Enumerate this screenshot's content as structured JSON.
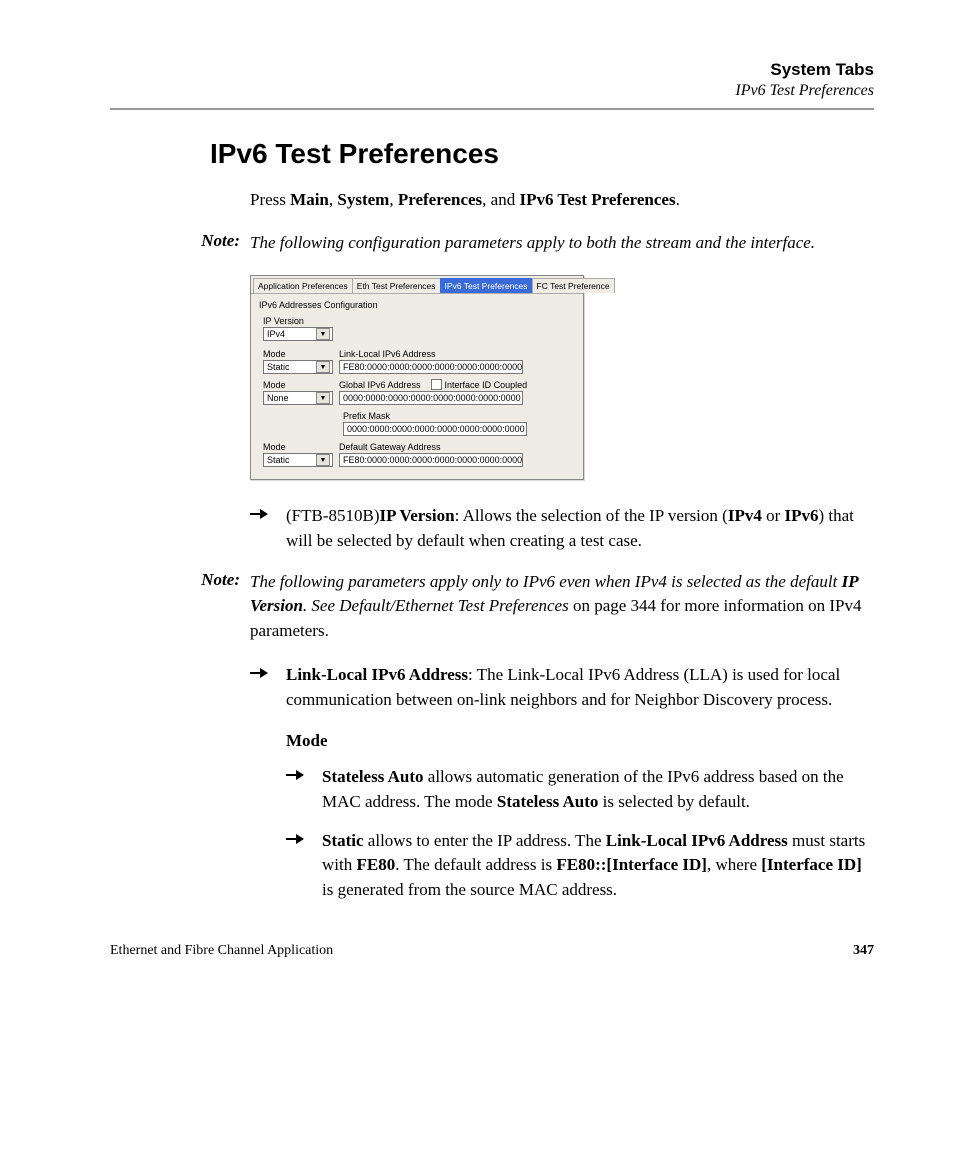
{
  "header": {
    "title": "System Tabs",
    "subtitle": "IPv6 Test Preferences"
  },
  "section_heading": "IPv6 Test Preferences",
  "intro": {
    "prefix": "Press ",
    "p1": "Main",
    "sep": ", ",
    "p2": "System",
    "p3": "Preferences",
    "sep_and": ", and ",
    "p4": "IPv6 Test Preferences",
    "suffix": "."
  },
  "note1": {
    "label": "Note:",
    "text": "The following configuration parameters apply to both the stream and the interface."
  },
  "panel": {
    "tabs": {
      "t1": "Application Preferences",
      "t2": "Eth Test Preferences",
      "t3": "IPv6 Test Preferences",
      "t4": "FC Test Preference"
    },
    "group": "IPv6 Addresses Configuration",
    "ip_version_label": "IP Version",
    "ip_version_value": "IPv4",
    "mode_label": "Mode",
    "mode_static": "Static",
    "mode_none": "None",
    "lla_label": "Link-Local IPv6 Address",
    "lla_value": "FE80:0000:0000:0000:0000:0000:0000:0000",
    "gia_label": "Global IPv6 Address",
    "gia_value": "0000:0000:0000:0000:0000:0000:0000:0000",
    "iid_coupled": "Interface ID Coupled",
    "prefix_label": "Prefix Mask",
    "prefix_value": "0000:0000:0000:0000:0000:0000:0000:0000",
    "dga_label": "Default Gateway Address",
    "dga_value": "FE80:0000:0000:0000:0000:0000:0000:0000"
  },
  "bullet1": {
    "model": "(FTB-8510B)",
    "b1": "IP Version",
    "t1": ": Allows the selection of the IP version (",
    "b2": "IPv4",
    "t2": " or ",
    "b3": "IPv6",
    "t3": ") that will be selected by default when creating a test case."
  },
  "note2": {
    "label": "Note:",
    "t1": "The following parameters apply only to IPv6 even when IPv4 is selected as the default ",
    "b1": "IP Version",
    "t2": ". See Default/Ethernet Test Preferences",
    "t3": " on page 344 for more information on IPv4 parameters."
  },
  "bullet2": {
    "b1": "Link-Local IPv6 Address",
    "t1": ": The Link-Local IPv6 Address (LLA) is used for local communication between on-link neighbors and for Neighbor Discovery process."
  },
  "mode_heading": "Mode",
  "sub1": {
    "b1": "Stateless Auto",
    "t1": " allows automatic generation of the IPv6 address based on the MAC address. The mode ",
    "b2": "Stateless Auto",
    "t2": " is selected by default."
  },
  "sub2": {
    "b1": "Static",
    "t1": " allows to enter the IP address. The ",
    "b2": "Link-Local IPv6 Address",
    "t2": " must starts with ",
    "b3": "FE80",
    "t3": ". The default address is ",
    "b4": "FE80::[Interface ID]",
    "t4": ", where ",
    "b5": "[Interface ID]",
    "t5": " is generated from the source MAC address."
  },
  "footer": {
    "left": "Ethernet and Fibre Channel Application",
    "page": "347"
  }
}
